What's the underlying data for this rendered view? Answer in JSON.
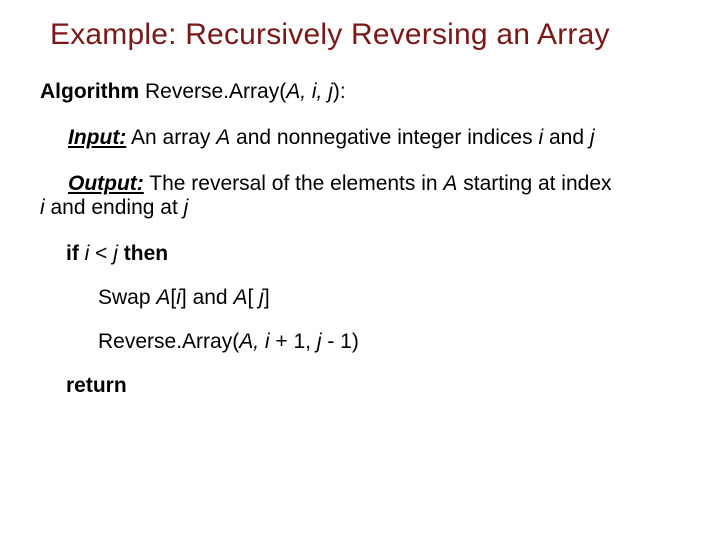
{
  "title": "Example:  Recursively Reversing an Array",
  "algoLine": {
    "kw": "Algorithm",
    "name": " Reverse.Array(",
    "arg1": "A,",
    "sp1": " ",
    "arg2": "i,",
    "sp2": "  ",
    "arg3": "j",
    "close": "):"
  },
  "input": {
    "label": "Input:",
    "t1": " An array ",
    "A": "A",
    "t2": " and nonnegative integer indices ",
    "i": "i",
    "t3": " and  ",
    "j": "j"
  },
  "output": {
    "label": "Output:",
    "t1": " The reversal of the elements in ",
    "A": "A",
    "t2": " starting at index",
    "line2a": "",
    "i": "i",
    "t3": " and ending at  ",
    "j": "j"
  },
  "ifline": {
    "kw_if": "if ",
    "i": "i",
    "lt": " <  ",
    "j": "j",
    "kw_then": " then"
  },
  "swap": {
    "t1": "Swap ",
    "A1": "A",
    "br1": "[",
    "i": "i",
    "mid": "] and ",
    "A2": "A",
    "br2": "[ ",
    "j": "j",
    "end": "]"
  },
  "recurse": {
    "t1": "Reverse.Array(",
    "A": "A,",
    "sp1": " ",
    "i": "i",
    "t2": " + 1,  ",
    "j": "j",
    "t3": " - 1)"
  },
  "ret": "return"
}
